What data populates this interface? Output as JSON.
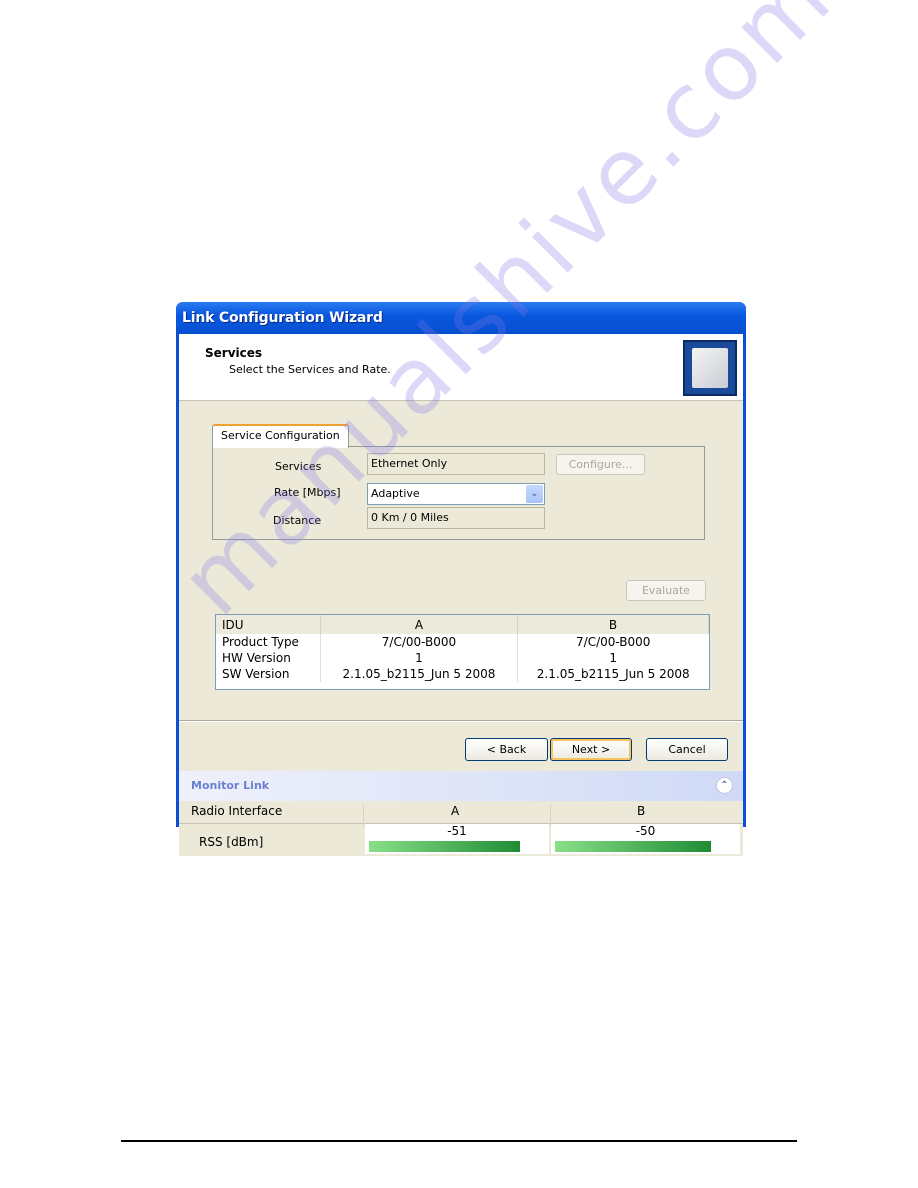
{
  "window": {
    "title": "Link Configuration Wizard"
  },
  "header": {
    "title": "Services",
    "subtitle": "Select the Services and Rate.",
    "logo_icon": "antenna-icon"
  },
  "service_config": {
    "tab_label": "Service Configuration",
    "services_label": "Services",
    "services_value": "Ethernet Only",
    "configure_button": "Configure...",
    "rate_label": "Rate [Mbps]",
    "rate_value": "Adaptive",
    "distance_label": "Distance",
    "distance_value": "0 Km / 0 Miles"
  },
  "evaluate_button": "Evaluate",
  "idu_table": {
    "headers": [
      "IDU",
      "A",
      "B"
    ],
    "rows": [
      [
        "Product Type",
        "7/C/00-B000",
        "7/C/00-B000"
      ],
      [
        "HW Version",
        "1",
        "1"
      ],
      [
        "SW Version",
        "2.1.05_b2115_Jun  5 2008",
        "2.1.05_b2115_Jun  5 2008"
      ]
    ]
  },
  "buttons": {
    "back": "< Back",
    "next": "Next >",
    "cancel": "Cancel"
  },
  "monitor": {
    "title": "Monitor Link",
    "headers": [
      "Radio Interface",
      "A",
      "B"
    ],
    "rss_label": "RSS [dBm]",
    "rss_a": "-51",
    "rss_b": "-50",
    "rss_a_fill": 0.86,
    "rss_b_fill": 0.86,
    "bar_color_start": "#88e088",
    "bar_color_end": "#1f8c34"
  },
  "watermark": "manualshive.com"
}
